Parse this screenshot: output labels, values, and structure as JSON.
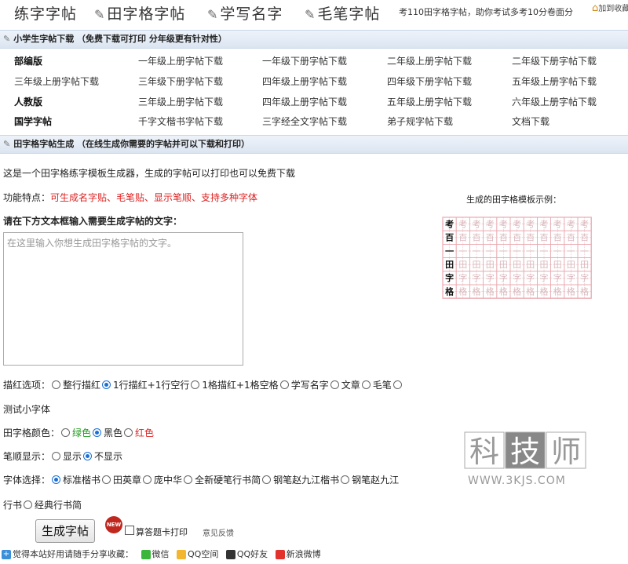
{
  "topnav": {
    "items": [
      "练字字帖",
      "田字格字帖",
      "学写名字",
      "毛笔字帖"
    ],
    "slogan": "考110田字格字帖，助你考试多考10分卷面分",
    "favorite": "加到收藏"
  },
  "section1": {
    "title": "小学生字帖下载  （免费下载可打印 分年级更有针对性）"
  },
  "downloads": [
    [
      "部编版",
      "一年级上册字帖下载",
      "一年级下册字帖下载",
      "二年级上册字帖下载",
      "二年级下册字帖下载"
    ],
    [
      "三年级上册字帖下载",
      "三年级下册字帖下载",
      "四年级上册字帖下载",
      "四年级下册字帖下载",
      "五年级上册字帖下载"
    ],
    [
      "人教版",
      "三年级上册字帖下载",
      "四年级上册字帖下载",
      "五年级上册字帖下载",
      "六年级上册字帖下载"
    ],
    [
      "国学字帖",
      "千字文楷书字帖下载",
      "三字经全文字帖下载",
      "弟子规字帖下载",
      "文档下载"
    ]
  ],
  "section2": {
    "title": "田字格字帖生成  （在线生成你需要的字帖并可以下载和打印）"
  },
  "intro": "这是一个田字格练字模板生成器，生成的字帖可以打印也可以免费下载",
  "features": {
    "label": "功能特点：",
    "text": "可生成名字贴、毛笔贴、显示笔顺、支持多种字体"
  },
  "sample_title": "生成的田字格模板示例：",
  "sample_chars": [
    "考",
    "百",
    "一",
    "田",
    "字",
    "格"
  ],
  "prompt": "请在下方文本框输入需要生成字帖的文字：",
  "textarea_placeholder": "在这里输入你想生成田字格字帖的文字。",
  "miaohong": {
    "label": "描红选项：",
    "options": [
      "整行描红",
      "1行描红+1行空行",
      "1格描红+1格空格",
      "学写名字",
      "文章",
      "毛笔"
    ],
    "selected": 1,
    "extra": "测试小字体"
  },
  "color": {
    "label": "田字格颜色：",
    "options": [
      "绿色",
      "黑色",
      "红色"
    ],
    "selected": 1
  },
  "stroke": {
    "label": "笔顺显示：",
    "options": [
      "显示",
      "不显示"
    ],
    "selected": 1
  },
  "font": {
    "label": "字体选择：",
    "options": [
      "标准楷书",
      "田英章",
      "庞中华",
      "全新硬笔行书简",
      "钢笔赵九江楷书",
      "钢笔赵九江行书",
      "经典行书简"
    ],
    "selected": 0
  },
  "generate_button": "生成字帖",
  "new_badge": "NEW",
  "quiz_card": "算答题卡打印",
  "feedback": "意见反馈",
  "share": {
    "label": "觉得本站好用请随手分享收藏：",
    "items": [
      "微信",
      "QQ空间",
      "QQ好友",
      "新浪微博"
    ]
  },
  "watermark": {
    "chars": [
      "科",
      "技",
      "师"
    ],
    "url": "WWW.3KJS.COM"
  },
  "colors": {
    "bar_bg": "#dbe5f1",
    "red": "#dd2222",
    "green": "#1a9a1a",
    "grid_pink": "#e8a9b0"
  }
}
